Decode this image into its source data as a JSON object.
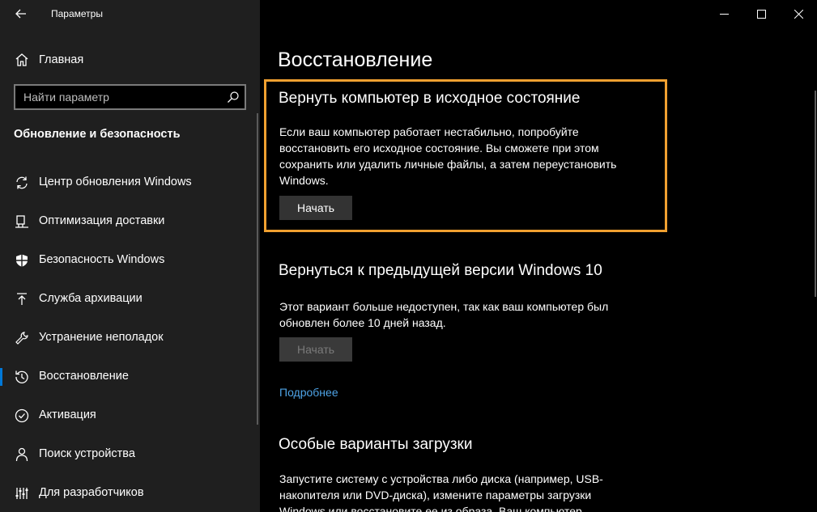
{
  "window": {
    "title": "Параметры"
  },
  "sidebar": {
    "home_label": "Главная",
    "search_placeholder": "Найти параметр",
    "section_title": "Обновление и безопасность",
    "items": [
      {
        "label": "Центр обновления Windows",
        "icon": "sync-icon"
      },
      {
        "label": "Оптимизация доставки",
        "icon": "delivery-optimization-icon"
      },
      {
        "label": "Безопасность Windows",
        "icon": "shield-icon"
      },
      {
        "label": "Служба архивации",
        "icon": "backup-arrow-icon"
      },
      {
        "label": "Устранение неполадок",
        "icon": "wrench-icon"
      },
      {
        "label": "Восстановление",
        "icon": "history-icon",
        "active": true
      },
      {
        "label": "Активация",
        "icon": "check-circle-icon"
      },
      {
        "label": "Поиск устройства",
        "icon": "person-pin-icon"
      },
      {
        "label": "Для разработчиков",
        "icon": "developer-tools-icon"
      }
    ]
  },
  "main": {
    "page_title": "Восстановление",
    "reset": {
      "heading": "Вернуть компьютер в исходное состояние",
      "lines": [
        "Если ваш компьютер работает нестабильно, попробуйте",
        "восстановить его исходное состояние. Вы сможете при этом",
        "сохранить или удалить личные файлы, а затем переустановить",
        "Windows."
      ],
      "button_label": "Начать"
    },
    "rollback": {
      "heading": "Вернуться к предыдущей версии Windows 10",
      "lines": [
        "Этот вариант больше недоступен, так как ваш компьютер был",
        "обновлен более 10 дней назад."
      ],
      "button_label": "Начать",
      "link": "Подробнее"
    },
    "advanced": {
      "heading": "Особые варианты загрузки",
      "lines": [
        "Запустите систему с устройства либо диска (например, USB-",
        "накопителя или DVD-диска), измените параметры загрузки",
        "Windows или восстановите ее из образа. Ваш компьютер"
      ]
    }
  },
  "colors": {
    "accent": "#0078d7",
    "highlight_border": "#f0a030",
    "link": "#4ea3e6",
    "sidebar_bg": "#1f1f1f",
    "main_bg": "#000000"
  }
}
